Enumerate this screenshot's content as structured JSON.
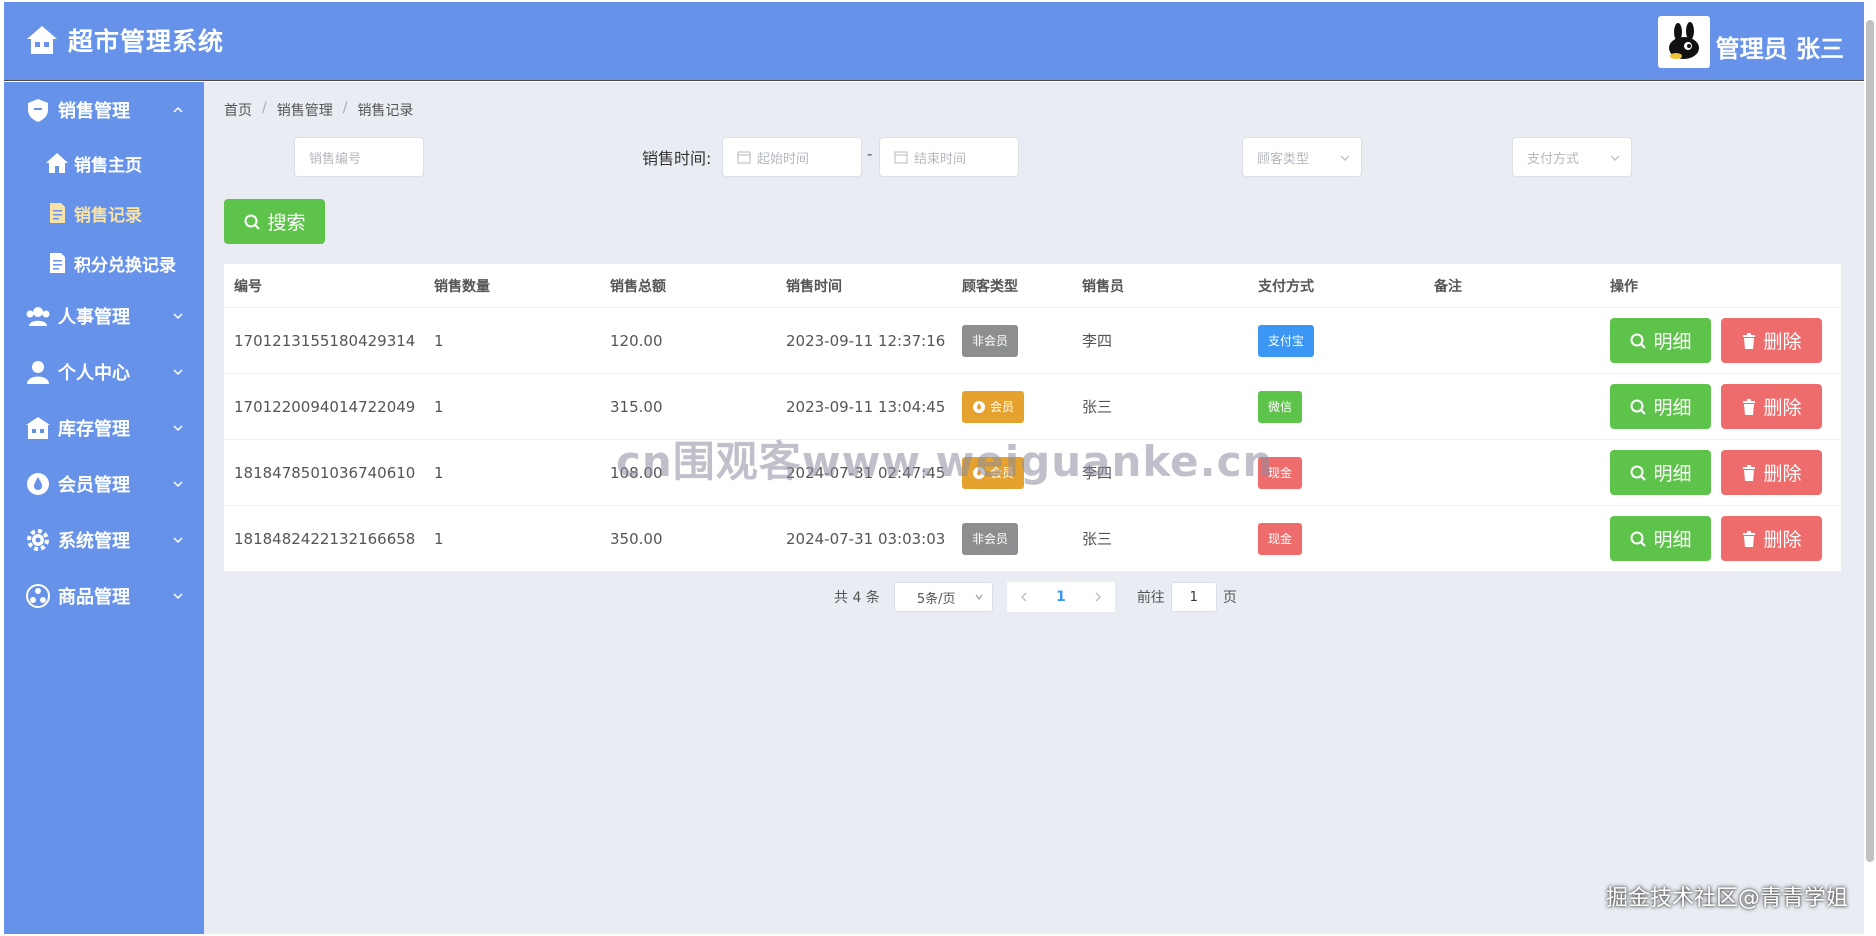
{
  "app": {
    "title": "超市管理系统",
    "user_label": "管理员 张三"
  },
  "sidebar": {
    "groups": [
      {
        "label": "销售管理",
        "icon": "shield-icon",
        "expanded": true,
        "items": [
          {
            "label": "销售主页",
            "icon": "home-icon",
            "active": false
          },
          {
            "label": "销售记录",
            "icon": "document-icon",
            "active": true
          },
          {
            "label": "积分兑换记录",
            "icon": "document-icon",
            "active": false
          }
        ]
      },
      {
        "label": "人事管理",
        "icon": "users-icon"
      },
      {
        "label": "个人中心",
        "icon": "user-icon"
      },
      {
        "label": "库存管理",
        "icon": "warehouse-icon"
      },
      {
        "label": "会员管理",
        "icon": "drop-icon"
      },
      {
        "label": "系统管理",
        "icon": "gear-icon"
      },
      {
        "label": "商品管理",
        "icon": "goods-icon"
      }
    ]
  },
  "breadcrumb": [
    "首页",
    "销售管理",
    "销售记录"
  ],
  "filters": {
    "sale_no_placeholder": "销售编号",
    "time_label": "销售时间:",
    "start_placeholder": "起始时间",
    "range_sep": "-",
    "end_placeholder": "结束时间",
    "customer_type_placeholder": "顾客类型",
    "pay_method_placeholder": "支付方式",
    "search_label": "搜索"
  },
  "table": {
    "columns": [
      "编号",
      "销售数量",
      "销售总额",
      "销售时间",
      "顾客类型",
      "销售员",
      "支付方式",
      "备注",
      "操作"
    ],
    "rows": [
      {
        "id": "1701213155180429314",
        "qty": "1",
        "total": "120.00",
        "time": "2023-09-11 12:37:16",
        "customer": "非会员",
        "customer_kind": "nonmember",
        "seller": "李四",
        "pay": "支付宝",
        "pay_kind": "alipay",
        "note": ""
      },
      {
        "id": "1701220094014722049",
        "qty": "1",
        "total": "315.00",
        "time": "2023-09-11 13:04:45",
        "customer": "会员",
        "customer_kind": "member",
        "seller": "张三",
        "pay": "微信",
        "pay_kind": "wechat",
        "note": ""
      },
      {
        "id": "1818478501036740610",
        "qty": "1",
        "total": "108.00",
        "time": "2024-07-31 02:47:45",
        "customer": "会员",
        "customer_kind": "member",
        "seller": "李四",
        "pay": "现金",
        "pay_kind": "cash",
        "note": ""
      },
      {
        "id": "1818482422132166658",
        "qty": "1",
        "total": "350.00",
        "time": "2024-07-31 03:03:03",
        "customer": "非会员",
        "customer_kind": "nonmember",
        "seller": "张三",
        "pay": "现金",
        "pay_kind": "cash",
        "note": ""
      }
    ],
    "detail_label": "明细",
    "delete_label": "删除"
  },
  "pagination": {
    "total": "共 4 条",
    "page_size": "5条/页",
    "current": "1",
    "goto_prefix": "前往",
    "goto_value": "1",
    "goto_suffix": "页"
  },
  "watermark": "cn围观客www.weiguanke.cn",
  "corner_mark": "掘金技术社区@青青学姐",
  "colors": {
    "header": "#6692ea",
    "sidebar": "#6692ea",
    "success": "#5ec34b",
    "danger": "#ef6c6c",
    "info": "#8d8e90",
    "warning": "#e5a22e",
    "primary": "#3c97f4"
  }
}
